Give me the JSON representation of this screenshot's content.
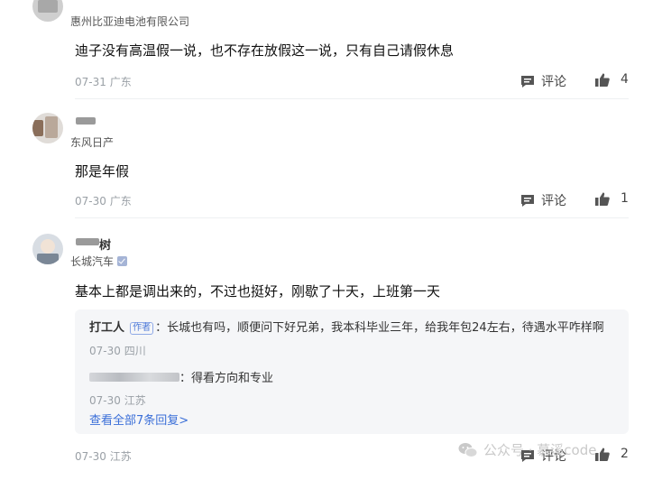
{
  "comments": [
    {
      "username": "",
      "org": "惠州比亚迪电池有限公司",
      "text": "迪子没有高温假一说，也不存在放假这一说，只有自己请假休息",
      "date": "07-31",
      "location": "广东",
      "comment_label": "评论",
      "likes": "4"
    },
    {
      "username": "",
      "org": "东风日产",
      "text": "那是年假",
      "date": "07-30",
      "location": "广东",
      "comment_label": "评论",
      "likes": "1"
    },
    {
      "username": "树",
      "org": "长城汽车",
      "text": "基本上都是调出来的，不过也挺好，刚歇了十天，上班第一天",
      "date": "07-30",
      "location": "江苏",
      "comment_label": "评论",
      "likes": "2",
      "replies": [
        {
          "name": "打工人",
          "tag": "作者",
          "text": "：长城也有吗，顺便问下好兄弟，我本科毕业三年，给我年包24左右，待遇水平咋样啊",
          "date": "07-30",
          "location": "四川"
        },
        {
          "name": "",
          "text": "：得看方向和专业",
          "date": "07-30",
          "location": "江苏"
        }
      ],
      "more_replies": "查看全部7条回复"
    }
  ],
  "watermark": "公众号 · 慕溪code",
  "colors": {
    "link": "#3b6fd8",
    "meta": "#9aa0a6",
    "tag": "#4f7bd9"
  }
}
